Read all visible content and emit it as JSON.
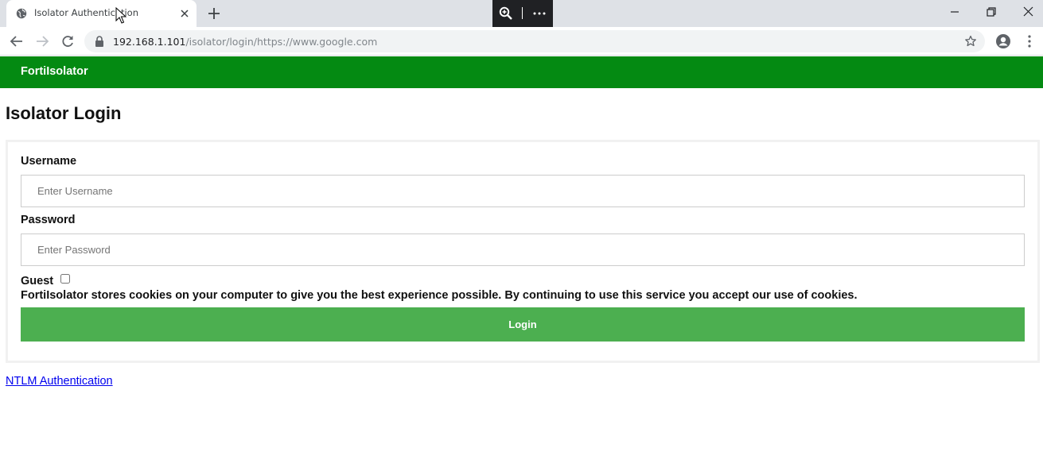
{
  "browser": {
    "tab_title": "Isolator Authentication",
    "url_host": "192.168.1.101",
    "url_path": "/isolator/login/https://www.google.com"
  },
  "header": {
    "brand": "FortiIsolator"
  },
  "login": {
    "title": "Isolator Login",
    "username_label": "Username",
    "username_placeholder": "Enter Username",
    "username_value": "",
    "password_label": "Password",
    "password_placeholder": "Enter Password",
    "password_value": "",
    "guest_label": "Guest",
    "guest_checked": false,
    "cookie_notice": "FortiIsolator stores cookies on your computer to give you the best experience possible. By continuing to use this service you accept our use of cookies.",
    "login_button": "Login"
  },
  "footer": {
    "ntlm_link": "NTLM Authentication"
  },
  "colors": {
    "header_bg": "#048a12",
    "button_bg": "#4caf50",
    "link": "#0000ee"
  }
}
